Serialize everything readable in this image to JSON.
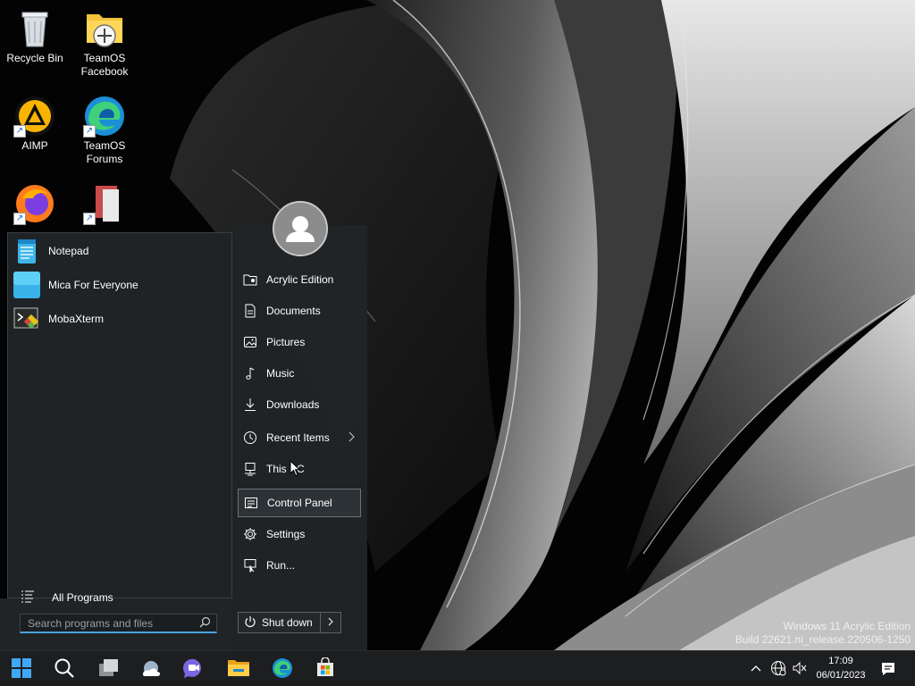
{
  "desktop": {
    "icons": [
      {
        "label": "Recycle Bin",
        "icon": "recycle-bin-icon"
      },
      {
        "label": "TeamOS Facebook",
        "icon": "folder-shortcut-icon"
      },
      {
        "label": "AIMP",
        "icon": "aimp-icon"
      },
      {
        "label": "TeamOS Forums",
        "icon": "edge-icon"
      },
      {
        "label": "",
        "icon": "firefox-icon"
      },
      {
        "label": "",
        "icon": "document-app-icon"
      }
    ]
  },
  "start_menu": {
    "recent_apps": [
      {
        "label": "Notepad",
        "icon": "notepad-icon"
      },
      {
        "label": "Mica For Everyone",
        "icon": "mica-icon"
      },
      {
        "label": "MobaXterm",
        "icon": "mobaxterm-icon"
      }
    ],
    "all_programs_label": "All Programs",
    "search_placeholder": "Search programs and files",
    "user_icon": "user-avatar-icon",
    "right_items": [
      {
        "label": "Acrylic Edition",
        "icon": "user-folder-icon"
      },
      {
        "label": "Documents",
        "icon": "document-icon"
      },
      {
        "label": "Pictures",
        "icon": "picture-icon"
      },
      {
        "label": "Music",
        "icon": "music-note-icon"
      },
      {
        "label": "Downloads",
        "icon": "download-icon"
      },
      {
        "label": "Recent Items",
        "icon": "clock-icon"
      },
      {
        "label": "This PC",
        "icon": "computer-icon"
      },
      {
        "label": "Control Panel",
        "icon": "control-panel-icon"
      },
      {
        "label": "Settings",
        "icon": "gear-icon"
      },
      {
        "label": "Run...",
        "icon": "run-icon"
      }
    ],
    "selected_item": "Control Panel",
    "shutdown_label": "Shut down"
  },
  "watermark": {
    "line1": "Windows 11 Acrylic Edition",
    "line2": "Build 22621.ni_release.220506-1250"
  },
  "taskbar": {
    "pinned": [
      "start-icon",
      "search-icon",
      "task-view-icon",
      "weather-icon",
      "chat-icon",
      "file-explorer-icon",
      "edge-icon",
      "store-icon"
    ],
    "tray": [
      "chevron-up-icon",
      "network-icon",
      "volume-muted-icon"
    ],
    "time": "17:09",
    "date": "06/01/2023",
    "notification_icon": "notification-icon"
  },
  "colors": {
    "accent": "#4aa3e0",
    "menu_bg": "#1f2326",
    "taskbar_bg": "#1c1e20"
  }
}
